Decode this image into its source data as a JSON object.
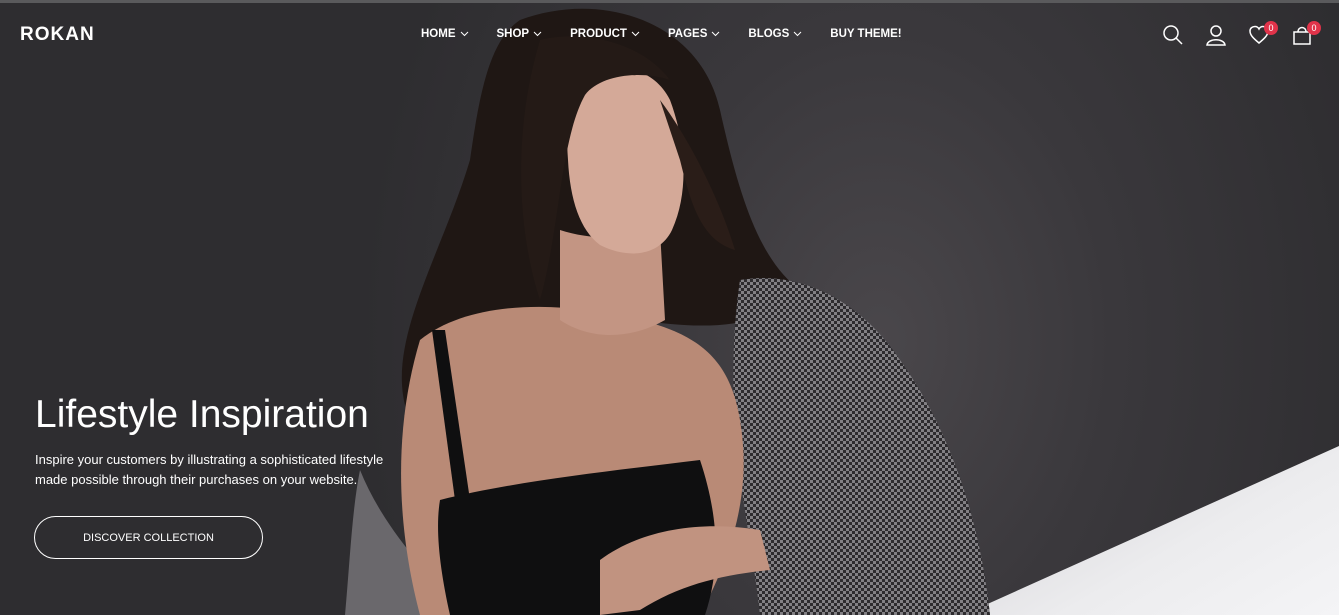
{
  "brand": {
    "logo_text": "ROKAN"
  },
  "nav": {
    "items": [
      {
        "label": "HOME",
        "has_dropdown": true
      },
      {
        "label": "SHOP",
        "has_dropdown": true
      },
      {
        "label": "PRODUCT",
        "has_dropdown": true
      },
      {
        "label": "PAGES",
        "has_dropdown": true
      },
      {
        "label": "BLOGS",
        "has_dropdown": true
      },
      {
        "label": "BUY THEME!",
        "has_dropdown": false
      }
    ]
  },
  "header_icons": {
    "search": "search-icon",
    "account": "user-icon",
    "wishlist": {
      "icon": "heart-icon",
      "count": "0"
    },
    "cart": {
      "icon": "shopping-bag-icon",
      "count": "0"
    }
  },
  "hero": {
    "title": "Lifestyle Inspiration",
    "subtitle_line1": "Inspire your customers by illustrating a sophisticated lifestyle",
    "subtitle_line2": "made possible through their purchases on your website.",
    "cta_label": "DISCOVER COLLECTION"
  },
  "colors": {
    "badge": "#e1334a",
    "text": "#ffffff",
    "background": "#2e2d30"
  }
}
